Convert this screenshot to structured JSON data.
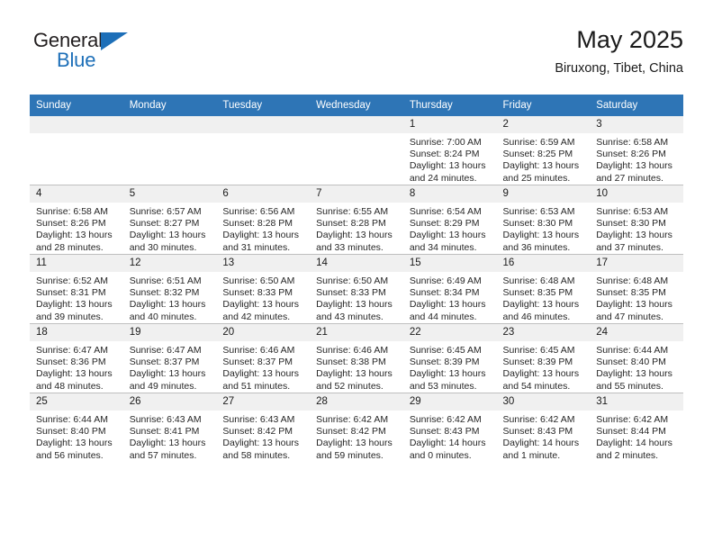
{
  "brand": {
    "name_top": "General",
    "name_bottom": "Blue"
  },
  "header": {
    "title": "May 2025",
    "subtitle": "Biruxong, Tibet, China"
  },
  "colors": {
    "header_blue": "#2e75b6",
    "brand_blue": "#1d6fb8",
    "daynum_band": "#f0f0f0",
    "cell_border": "#bfbfbf"
  },
  "weekday_headers": [
    "Sunday",
    "Monday",
    "Tuesday",
    "Wednesday",
    "Thursday",
    "Friday",
    "Saturday"
  ],
  "weeks": [
    [
      {
        "day": "",
        "sunrise": "",
        "sunset": "",
        "daylight": "",
        "empty": true
      },
      {
        "day": "",
        "sunrise": "",
        "sunset": "",
        "daylight": "",
        "empty": true
      },
      {
        "day": "",
        "sunrise": "",
        "sunset": "",
        "daylight": "",
        "empty": true
      },
      {
        "day": "",
        "sunrise": "",
        "sunset": "",
        "daylight": "",
        "empty": true
      },
      {
        "day": "1",
        "sunrise": "Sunrise: 7:00 AM",
        "sunset": "Sunset: 8:24 PM",
        "daylight": "Daylight: 13 hours and 24 minutes."
      },
      {
        "day": "2",
        "sunrise": "Sunrise: 6:59 AM",
        "sunset": "Sunset: 8:25 PM",
        "daylight": "Daylight: 13 hours and 25 minutes."
      },
      {
        "day": "3",
        "sunrise": "Sunrise: 6:58 AM",
        "sunset": "Sunset: 8:26 PM",
        "daylight": "Daylight: 13 hours and 27 minutes."
      }
    ],
    [
      {
        "day": "4",
        "sunrise": "Sunrise: 6:58 AM",
        "sunset": "Sunset: 8:26 PM",
        "daylight": "Daylight: 13 hours and 28 minutes."
      },
      {
        "day": "5",
        "sunrise": "Sunrise: 6:57 AM",
        "sunset": "Sunset: 8:27 PM",
        "daylight": "Daylight: 13 hours and 30 minutes."
      },
      {
        "day": "6",
        "sunrise": "Sunrise: 6:56 AM",
        "sunset": "Sunset: 8:28 PM",
        "daylight": "Daylight: 13 hours and 31 minutes."
      },
      {
        "day": "7",
        "sunrise": "Sunrise: 6:55 AM",
        "sunset": "Sunset: 8:28 PM",
        "daylight": "Daylight: 13 hours and 33 minutes."
      },
      {
        "day": "8",
        "sunrise": "Sunrise: 6:54 AM",
        "sunset": "Sunset: 8:29 PM",
        "daylight": "Daylight: 13 hours and 34 minutes."
      },
      {
        "day": "9",
        "sunrise": "Sunrise: 6:53 AM",
        "sunset": "Sunset: 8:30 PM",
        "daylight": "Daylight: 13 hours and 36 minutes."
      },
      {
        "day": "10",
        "sunrise": "Sunrise: 6:53 AM",
        "sunset": "Sunset: 8:30 PM",
        "daylight": "Daylight: 13 hours and 37 minutes."
      }
    ],
    [
      {
        "day": "11",
        "sunrise": "Sunrise: 6:52 AM",
        "sunset": "Sunset: 8:31 PM",
        "daylight": "Daylight: 13 hours and 39 minutes."
      },
      {
        "day": "12",
        "sunrise": "Sunrise: 6:51 AM",
        "sunset": "Sunset: 8:32 PM",
        "daylight": "Daylight: 13 hours and 40 minutes."
      },
      {
        "day": "13",
        "sunrise": "Sunrise: 6:50 AM",
        "sunset": "Sunset: 8:33 PM",
        "daylight": "Daylight: 13 hours and 42 minutes."
      },
      {
        "day": "14",
        "sunrise": "Sunrise: 6:50 AM",
        "sunset": "Sunset: 8:33 PM",
        "daylight": "Daylight: 13 hours and 43 minutes."
      },
      {
        "day": "15",
        "sunrise": "Sunrise: 6:49 AM",
        "sunset": "Sunset: 8:34 PM",
        "daylight": "Daylight: 13 hours and 44 minutes."
      },
      {
        "day": "16",
        "sunrise": "Sunrise: 6:48 AM",
        "sunset": "Sunset: 8:35 PM",
        "daylight": "Daylight: 13 hours and 46 minutes."
      },
      {
        "day": "17",
        "sunrise": "Sunrise: 6:48 AM",
        "sunset": "Sunset: 8:35 PM",
        "daylight": "Daylight: 13 hours and 47 minutes."
      }
    ],
    [
      {
        "day": "18",
        "sunrise": "Sunrise: 6:47 AM",
        "sunset": "Sunset: 8:36 PM",
        "daylight": "Daylight: 13 hours and 48 minutes."
      },
      {
        "day": "19",
        "sunrise": "Sunrise: 6:47 AM",
        "sunset": "Sunset: 8:37 PM",
        "daylight": "Daylight: 13 hours and 49 minutes."
      },
      {
        "day": "20",
        "sunrise": "Sunrise: 6:46 AM",
        "sunset": "Sunset: 8:37 PM",
        "daylight": "Daylight: 13 hours and 51 minutes."
      },
      {
        "day": "21",
        "sunrise": "Sunrise: 6:46 AM",
        "sunset": "Sunset: 8:38 PM",
        "daylight": "Daylight: 13 hours and 52 minutes."
      },
      {
        "day": "22",
        "sunrise": "Sunrise: 6:45 AM",
        "sunset": "Sunset: 8:39 PM",
        "daylight": "Daylight: 13 hours and 53 minutes."
      },
      {
        "day": "23",
        "sunrise": "Sunrise: 6:45 AM",
        "sunset": "Sunset: 8:39 PM",
        "daylight": "Daylight: 13 hours and 54 minutes."
      },
      {
        "day": "24",
        "sunrise": "Sunrise: 6:44 AM",
        "sunset": "Sunset: 8:40 PM",
        "daylight": "Daylight: 13 hours and 55 minutes."
      }
    ],
    [
      {
        "day": "25",
        "sunrise": "Sunrise: 6:44 AM",
        "sunset": "Sunset: 8:40 PM",
        "daylight": "Daylight: 13 hours and 56 minutes."
      },
      {
        "day": "26",
        "sunrise": "Sunrise: 6:43 AM",
        "sunset": "Sunset: 8:41 PM",
        "daylight": "Daylight: 13 hours and 57 minutes."
      },
      {
        "day": "27",
        "sunrise": "Sunrise: 6:43 AM",
        "sunset": "Sunset: 8:42 PM",
        "daylight": "Daylight: 13 hours and 58 minutes."
      },
      {
        "day": "28",
        "sunrise": "Sunrise: 6:42 AM",
        "sunset": "Sunset: 8:42 PM",
        "daylight": "Daylight: 13 hours and 59 minutes."
      },
      {
        "day": "29",
        "sunrise": "Sunrise: 6:42 AM",
        "sunset": "Sunset: 8:43 PM",
        "daylight": "Daylight: 14 hours and 0 minutes."
      },
      {
        "day": "30",
        "sunrise": "Sunrise: 6:42 AM",
        "sunset": "Sunset: 8:43 PM",
        "daylight": "Daylight: 14 hours and 1 minute."
      },
      {
        "day": "31",
        "sunrise": "Sunrise: 6:42 AM",
        "sunset": "Sunset: 8:44 PM",
        "daylight": "Daylight: 14 hours and 2 minutes."
      }
    ]
  ]
}
